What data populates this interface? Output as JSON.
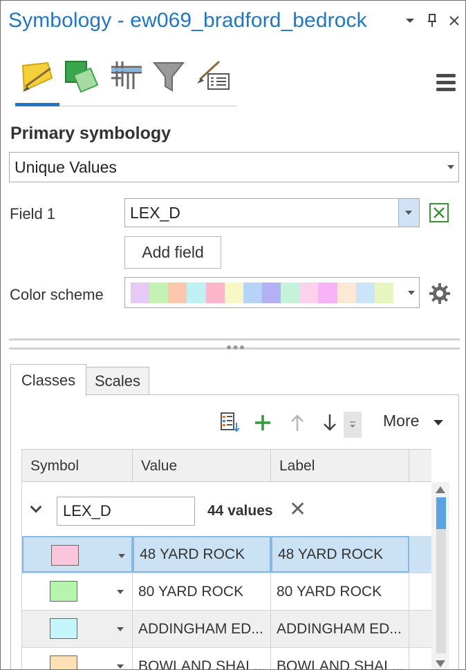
{
  "window": {
    "title": "Symbology - ew069_bradford_bedrock",
    "menu_arrow_icon": "chevron-down-icon",
    "pin_icon": "pin-icon",
    "close_glyph": "✕"
  },
  "tools": {
    "items": [
      "primary-symbology-icon",
      "vary-symbology-icon",
      "symbol-layer-drawing-icon",
      "symbol-filter-icon",
      "label-symbology-icon"
    ],
    "active": 0,
    "menu_icon": "hamburger-menu-icon"
  },
  "primary_symbology": {
    "heading": "Primary symbology",
    "method": "Unique Values",
    "field1_label": "Field 1",
    "field1_value": "LEX_D",
    "add_field_label": "Add field",
    "color_scheme_label": "Color scheme",
    "color_scheme_swatches": [
      "#e6c9f5",
      "#c4f2b3",
      "#fcc8ad",
      "#bff0f3",
      "#fbb6c9",
      "#f8f8c6",
      "#b7d3f8",
      "#b3b0f6",
      "#c4f3d9",
      "#fbd2ec",
      "#f8b3f7",
      "#fde7d5",
      "#cae5f9",
      "#e7f6c0"
    ],
    "accent_color": "#1f76c2"
  },
  "tabs": [
    {
      "label": "Classes",
      "active": true
    },
    {
      "label": "Scales",
      "active": false
    }
  ],
  "toolbar": {
    "more_label": "More"
  },
  "table": {
    "columns": [
      "Symbol",
      "Value",
      "Label"
    ],
    "group": {
      "field": "LEX_D",
      "count": "44 values"
    },
    "rows": [
      {
        "value": "48 YARD ROCK",
        "label": "48 YARD ROCK",
        "color": "#f9c6dc",
        "selected": true
      },
      {
        "value": "80 YARD ROCK",
        "label": "80 YARD ROCK",
        "color": "#b6f5ae",
        "selected": false
      },
      {
        "value": "ADDINGHAM ED...",
        "label": "ADDINGHAM ED...",
        "color": "#c4f6fb",
        "selected": false
      },
      {
        "value": "BOWLAND SHAL...",
        "label": "BOWLAND SHAL...",
        "color": "#fde0b6",
        "selected": false
      }
    ]
  }
}
